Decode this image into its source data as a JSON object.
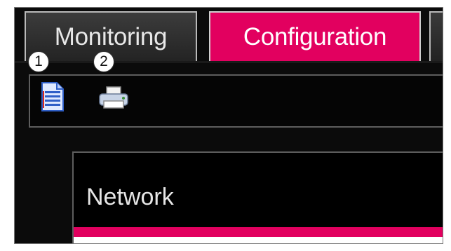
{
  "tabs": [
    {
      "label": "Monitoring",
      "active": false
    },
    {
      "label": "Configuration",
      "active": true
    }
  ],
  "toolbar": {
    "items": [
      {
        "icon": "document-icon",
        "callout": "1"
      },
      {
        "icon": "printer-icon",
        "callout": "2"
      }
    ]
  },
  "panel": {
    "title": "Network"
  },
  "colors": {
    "accent": "#e2005f",
    "background": "#0b0b0b",
    "frame_border": "#5d5d5d"
  }
}
